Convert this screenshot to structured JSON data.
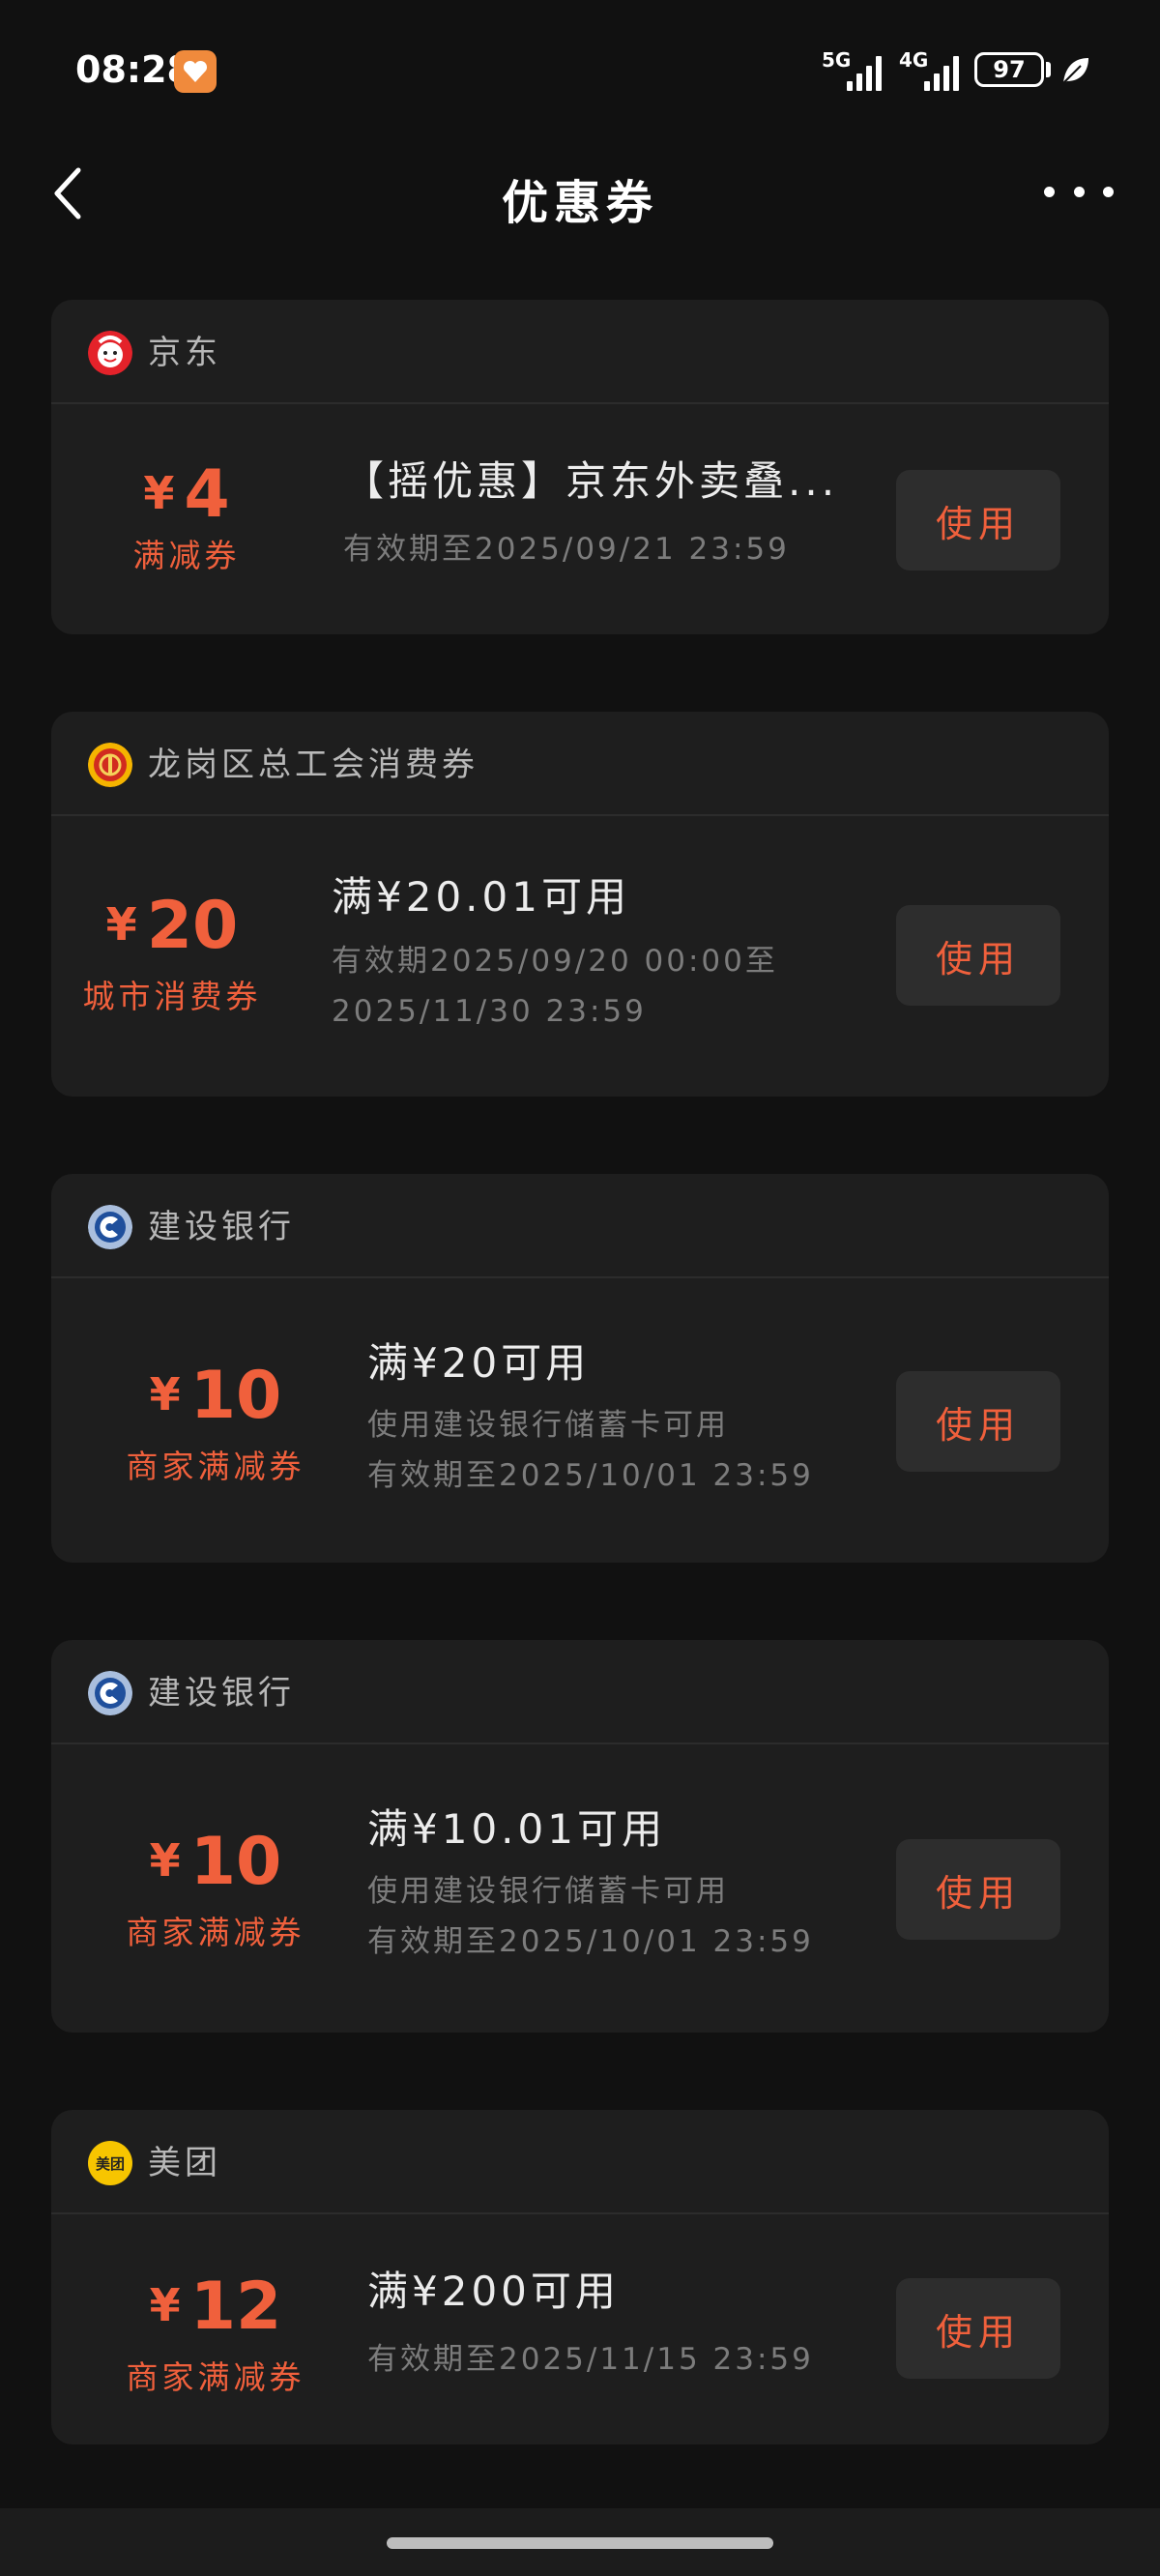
{
  "status": {
    "time": "08:28",
    "net1": "5G",
    "net2": "4G",
    "battery": "97"
  },
  "header": {
    "title": "优惠券"
  },
  "coupons": [
    {
      "merchant": "京东",
      "currency": "¥",
      "amount": "4",
      "type": "满减券",
      "title": "【摇优惠】京东外卖叠...",
      "lines": [
        "有效期至2025/09/21 23:59"
      ],
      "button": "使用"
    },
    {
      "merchant": "龙岗区总工会消费券",
      "currency": "¥",
      "amount": "20",
      "type": "城市消费券",
      "title": "满¥20.01可用",
      "lines": [
        "有效期2025/09/20 00:00至",
        "2025/11/30 23:59"
      ],
      "button": "使用"
    },
    {
      "merchant": "建设银行",
      "currency": "¥",
      "amount": "10",
      "type": "商家满减券",
      "title": "满¥20可用",
      "lines": [
        "使用建设银行储蓄卡可用",
        "有效期至2025/10/01 23:59"
      ],
      "button": "使用"
    },
    {
      "merchant": "建设银行",
      "currency": "¥",
      "amount": "10",
      "type": "商家满减券",
      "title": "满¥10.01可用",
      "lines": [
        "使用建设银行储蓄卡可用",
        "有效期至2025/10/01 23:59"
      ],
      "button": "使用"
    },
    {
      "merchant": "美团",
      "logo_text": "美团",
      "currency": "¥",
      "amount": "12",
      "type": "商家满减券",
      "title": "满¥200可用",
      "lines": [
        "有效期至2025/11/15 23:59"
      ],
      "button": "使用"
    }
  ],
  "icons": {
    "back": "chevron-left-icon",
    "more": "more-dots-icon",
    "jd": "jd-logo-icon",
    "union": "union-emblem-icon",
    "ccb": "ccb-logo-icon",
    "meituan": "meituan-logo-icon"
  },
  "colors": {
    "accent": "#f0603c",
    "card": "#1e1e1e",
    "background": "#111111"
  }
}
